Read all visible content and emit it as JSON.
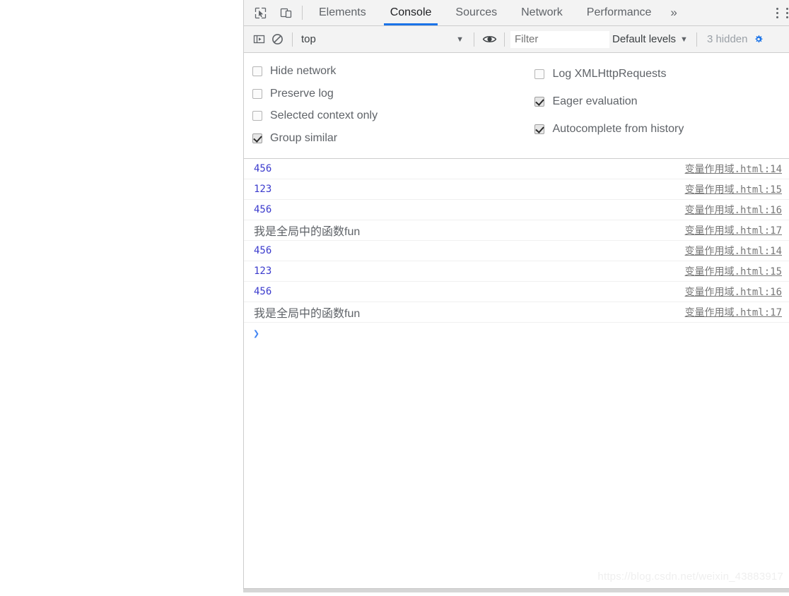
{
  "tabbar": {
    "inspect_icon": "cursor-select-icon",
    "device_icon": "device-toolbar-icon",
    "tabs": [
      {
        "label": "Elements",
        "active": false
      },
      {
        "label": "Console",
        "active": true
      },
      {
        "label": "Sources",
        "active": false
      },
      {
        "label": "Network",
        "active": false
      },
      {
        "label": "Performance",
        "active": false
      }
    ],
    "more_tabs": "»",
    "menu_icon": "more-vertical-icon"
  },
  "filterbar": {
    "sidebar_toggle_icon": "console-sidebar-icon",
    "clear_icon": "clear-console-icon",
    "context": "top",
    "context_caret": "▼",
    "eye_icon": "live-expression-icon",
    "filter_placeholder": "Filter",
    "filter_value": "",
    "levels_label": "Default levels",
    "levels_caret": "▼",
    "hidden_label": "3 hidden",
    "settings_icon": "settings-gear-icon"
  },
  "settings": {
    "left": [
      {
        "label": "Hide network",
        "checked": false
      },
      {
        "label": "Preserve log",
        "checked": false
      },
      {
        "label": "Selected context only",
        "checked": false
      },
      {
        "label": "Group similar",
        "checked": true
      }
    ],
    "right": [
      {
        "label": "Log XMLHttpRequests",
        "checked": false
      },
      {
        "label": "Eager evaluation",
        "checked": true
      },
      {
        "label": "Autocomplete from history",
        "checked": true
      }
    ]
  },
  "console": {
    "messages": [
      {
        "text": "456",
        "kind": "num",
        "source": "变量作用域.html:14"
      },
      {
        "text": "123",
        "kind": "num",
        "source": "变量作用域.html:15"
      },
      {
        "text": "456",
        "kind": "num",
        "source": "变量作用域.html:16"
      },
      {
        "text": "我是全局中的函数fun",
        "kind": "str",
        "source": "变量作用域.html:17"
      },
      {
        "text": "456",
        "kind": "num",
        "source": "变量作用域.html:14"
      },
      {
        "text": "123",
        "kind": "num",
        "source": "变量作用域.html:15"
      },
      {
        "text": "456",
        "kind": "num",
        "source": "变量作用域.html:16"
      },
      {
        "text": "我是全局中的函数fun",
        "kind": "str",
        "source": "变量作用域.html:17"
      }
    ],
    "prompt": "❯",
    "input_value": ""
  },
  "watermark": "https://blog.csdn.net/weixin_43883917",
  "colors": {
    "accent": "#1a73e8",
    "number": "#3b3bcd",
    "text": "#5f6368",
    "link": "#777777",
    "toolbar_bg": "#f3f3f3",
    "border": "#cdcdcd"
  }
}
